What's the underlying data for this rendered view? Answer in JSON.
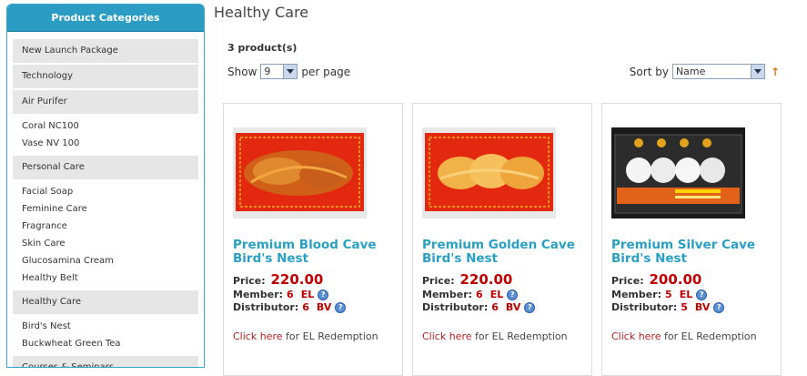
{
  "sidebar": {
    "title": "Product Categories",
    "groups": [
      {
        "label": "New Launch Package",
        "subs": []
      },
      {
        "label": "Technology",
        "subs": []
      },
      {
        "label": "Air Purifer",
        "subs": [
          "Coral NC100",
          "Vase NV 100"
        ]
      },
      {
        "label": "Personal Care",
        "subs": [
          "Facial Soap",
          "Feminine Care",
          "Fragrance",
          "Skin Care",
          "Glucosamina Cream",
          "Healthy Belt"
        ]
      },
      {
        "label": "Healthy Care",
        "subs": [
          "Bird's Nest",
          "Buckwheat Green Tea"
        ]
      },
      {
        "label": "Courses & Seminars",
        "subs": []
      }
    ]
  },
  "main": {
    "title": "Healthy Care",
    "count_text": "3 product(s)",
    "show_label": "Show",
    "per_page_value": "9",
    "per_page_label": "per page",
    "sort_label": "Sort by",
    "sort_value": "Name",
    "sort_direction_icon": "↑"
  },
  "products": [
    {
      "name": "Premium Blood Cave Bird's Nest",
      "price_label": "Price:",
      "price": "220.00",
      "member_label": "Member:",
      "member_value": "6",
      "member_unit": "EL",
      "distributor_label": "Distributor:",
      "distributor_value": "6",
      "distributor_unit": "BV",
      "link_text": "Click here",
      "link_suffix": "for EL Redemption",
      "image": "blood-nest"
    },
    {
      "name": "Premium Golden Cave Bird's Nest",
      "price_label": "Price:",
      "price": "220.00",
      "member_label": "Member:",
      "member_value": "6",
      "member_unit": "EL",
      "distributor_label": "Distributor:",
      "distributor_value": "6",
      "distributor_unit": "BV",
      "link_text": "Click here",
      "link_suffix": "for EL Redemption",
      "image": "golden-nest"
    },
    {
      "name": "Premium Silver Cave Bird's Nest",
      "price_label": "Price:",
      "price": "200.00",
      "member_label": "Member:",
      "member_value": "5",
      "member_unit": "EL",
      "distributor_label": "Distributor:",
      "distributor_value": "5",
      "distributor_unit": "BV",
      "link_text": "Click here",
      "link_suffix": "for EL Redemption",
      "image": "silver-nest"
    }
  ],
  "colors": {
    "accent": "#2b9cc4",
    "price": "#c00000",
    "link": "#b32020"
  }
}
